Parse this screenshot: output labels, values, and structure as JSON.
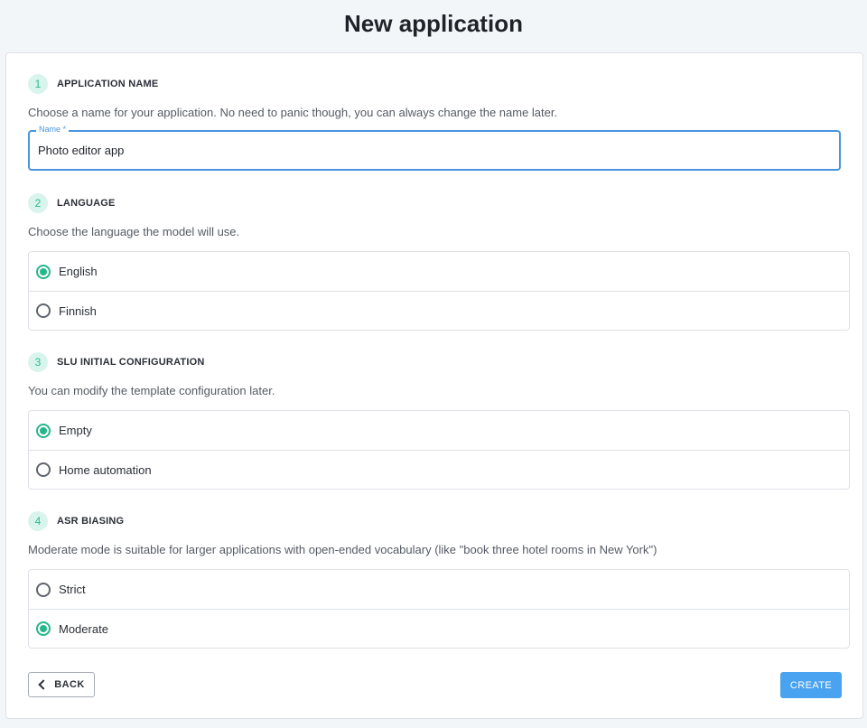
{
  "page": {
    "title": "New application"
  },
  "sections": [
    {
      "number": "1",
      "title": "APPLICATION NAME",
      "description": "Choose a name for your application. No need to panic though, you can always change the name later.",
      "field": {
        "label": "Name *",
        "value": "Photo editor app"
      }
    },
    {
      "number": "2",
      "title": "LANGUAGE",
      "description": "Choose the language the model will use.",
      "options": [
        {
          "label": "English",
          "selected": true
        },
        {
          "label": "Finnish",
          "selected": false
        }
      ]
    },
    {
      "number": "3",
      "title": "SLU INITIAL CONFIGURATION",
      "description": "You can modify the template configuration later.",
      "options": [
        {
          "label": "Empty",
          "selected": true
        },
        {
          "label": "Home automation",
          "selected": false
        }
      ]
    },
    {
      "number": "4",
      "title": "ASR BIASING",
      "description": "Moderate mode is suitable for larger applications with open-ended vocabulary (like \"book three hotel rooms in New York\")",
      "options": [
        {
          "label": "Strict",
          "selected": false
        },
        {
          "label": "Moderate",
          "selected": true
        }
      ]
    }
  ],
  "buttons": {
    "back": "BACK",
    "create": "CREATE"
  },
  "colors": {
    "accent_green": "#26b789",
    "accent_blue": "#4aa3f0",
    "field_focus": "#4a95e0"
  }
}
